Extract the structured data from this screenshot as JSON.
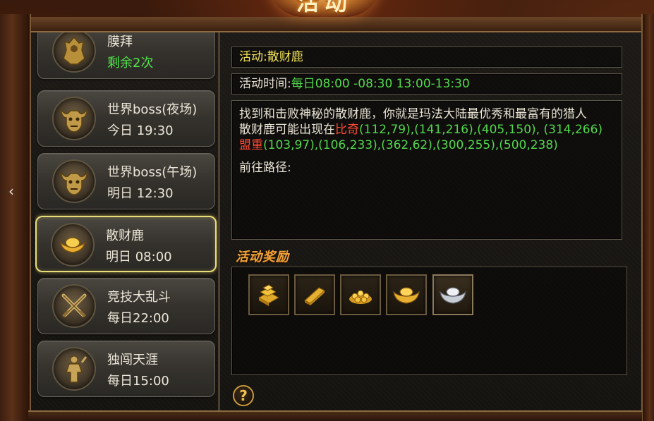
{
  "title": {
    "text": "活动"
  },
  "events": [
    {
      "name": "膜拜",
      "time": "剩余2次",
      "icon": "warrior-armor-icon",
      "time_style": "green"
    },
    {
      "name": "世界boss(夜场)",
      "time": "今日 19:30",
      "icon": "bull-demon-icon"
    },
    {
      "name": "世界boss(午场)",
      "time": "明日 12:30",
      "icon": "bull-demon-icon"
    },
    {
      "name": "散财鹿",
      "time": "明日 08:00",
      "icon": "gold-ingot-icon",
      "selected": true
    },
    {
      "name": "竞技大乱斗",
      "time": "每日22:00",
      "icon": "crossed-swords-icon"
    },
    {
      "name": "独闯天涯",
      "time": "每日15:00",
      "icon": "lone-warrior-icon"
    }
  ],
  "detail": {
    "activity_label": "活动:",
    "activity_name": "散财鹿",
    "time_label": "活动时间:",
    "time_value": "每日08:00 -08:30 13:00-13:30",
    "desc_line1": "找到和击败神秘的散财鹿，你就是玛法大陆最优秀和最富有的猎人",
    "desc_line2_prefix": "散财鹿可能出现在",
    "place1": "比奇",
    "place1_coords": "(112,79),(141,216),(405,150), (314,266)",
    "place2": "盟重",
    "place2_coords": "(103,97),(106,233),(362,62),(300,255),(500,238)",
    "route_label": "前往路径:"
  },
  "rewards": {
    "title": "活动奖励",
    "items": [
      {
        "icon": "gold-bars-stack-icon"
      },
      {
        "icon": "gold-bar-icon"
      },
      {
        "icon": "gold-coins-pile-icon"
      },
      {
        "icon": "gold-yuanbao-icon"
      },
      {
        "icon": "silver-yuanbao-icon"
      }
    ]
  },
  "help_label": "?",
  "collapse_arrow": "‹",
  "colors": {
    "highlight_yellow": "#f3e35a",
    "time_green": "#52d84c",
    "place_red": "#ff4a34",
    "selected_border": "#e9dd7a",
    "reward_title": "#f0a43a"
  }
}
